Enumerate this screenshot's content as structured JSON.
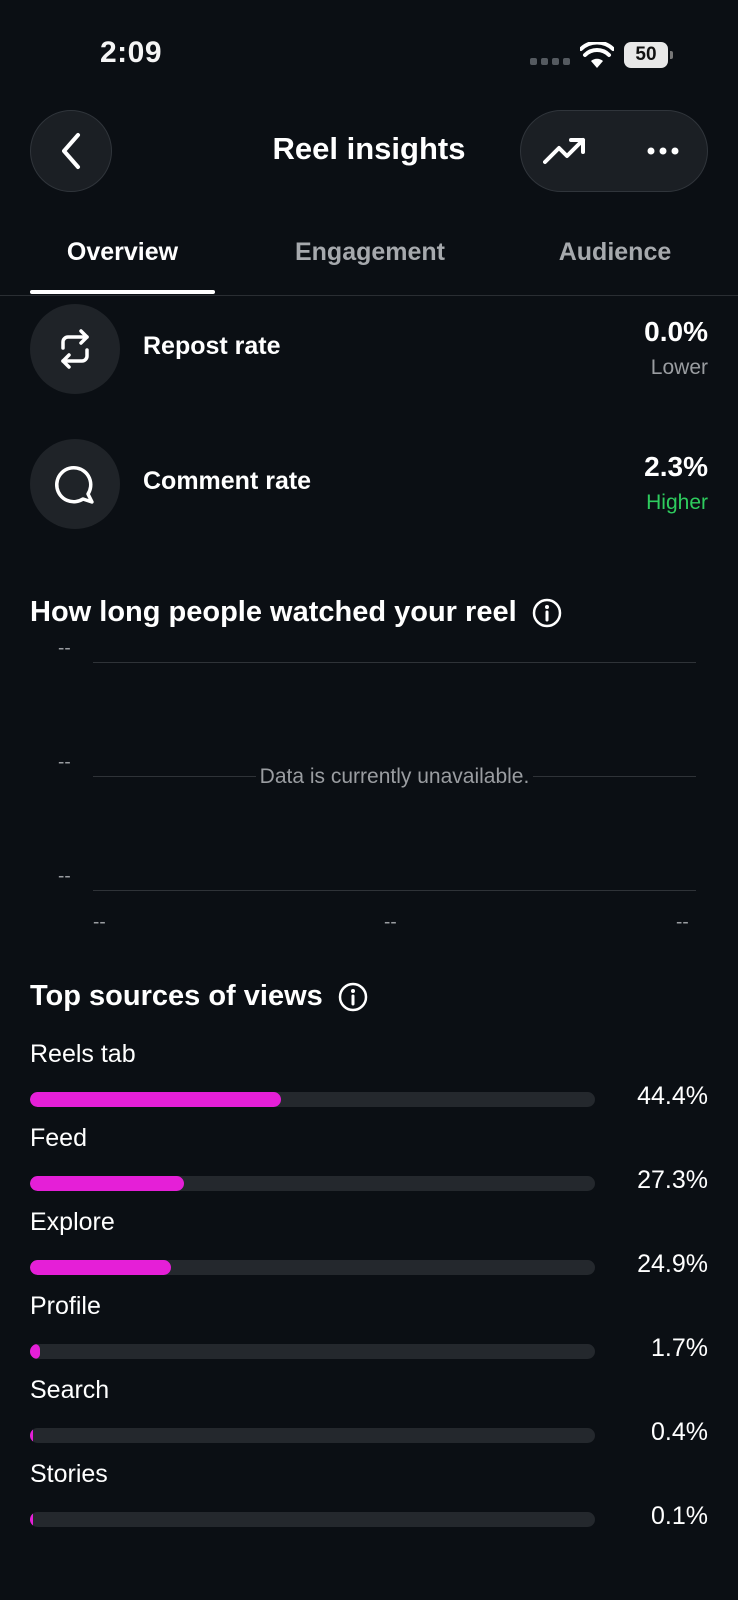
{
  "status_bar": {
    "time": "2:09",
    "battery": "50"
  },
  "header": {
    "title": "Reel insights",
    "back_icon": "chevron-left-icon",
    "trend_icon": "trending-up-icon",
    "more_icon": "more-horizontal-icon"
  },
  "tabs": [
    {
      "label": "Overview",
      "active": true
    },
    {
      "label": "Engagement",
      "active": false
    },
    {
      "label": "Audience",
      "active": false
    }
  ],
  "metrics": [
    {
      "label": "Repost rate",
      "value": "0.0%",
      "comparison": "Lower",
      "icon": "repost-icon"
    },
    {
      "label": "Comment rate",
      "value": "2.3%",
      "comparison": "Higher",
      "icon": "comment-icon"
    }
  ],
  "watch_chart": {
    "heading": "How long people watched your reel",
    "y_ticks": [
      "--",
      "--",
      "--"
    ],
    "x_ticks": [
      "--",
      "--",
      "--"
    ],
    "message": "Data is currently unavailable."
  },
  "sources": {
    "heading": "Top sources of views",
    "accent_color": "#e51fd7",
    "items": [
      {
        "label": "Reels tab",
        "value": "44.4%",
        "percent": 44.4
      },
      {
        "label": "Feed",
        "value": "27.3%",
        "percent": 27.3
      },
      {
        "label": "Explore",
        "value": "24.9%",
        "percent": 24.9
      },
      {
        "label": "Profile",
        "value": "1.7%",
        "percent": 1.7
      },
      {
        "label": "Search",
        "value": "0.4%",
        "percent": 0.4
      },
      {
        "label": "Stories",
        "value": "0.1%",
        "percent": 0.1
      }
    ]
  }
}
